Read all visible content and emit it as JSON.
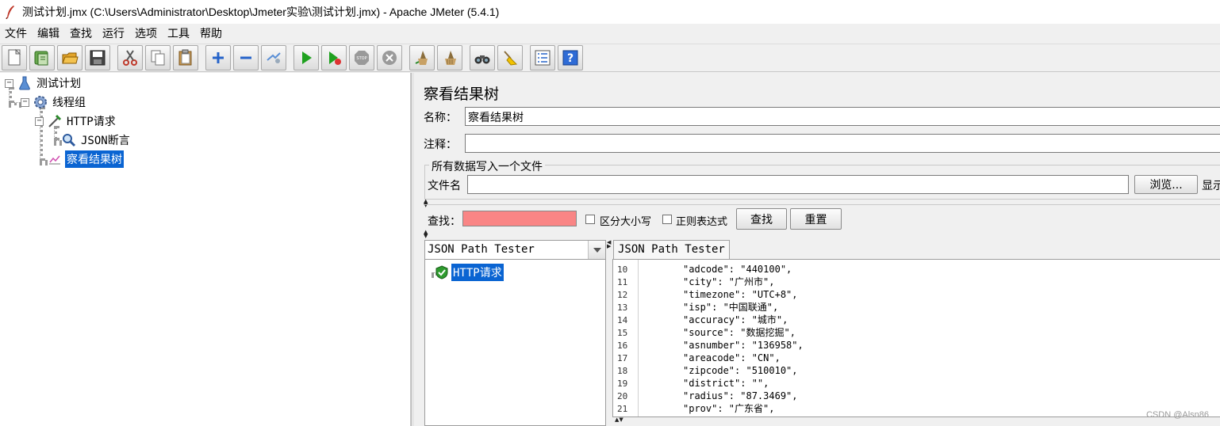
{
  "window": {
    "title": "测试计划.jmx (C:\\Users\\Administrator\\Desktop\\Jmeter实验\\测试计划.jmx) - Apache JMeter (5.4.1)"
  },
  "menu": [
    "文件",
    "编辑",
    "查找",
    "运行",
    "选项",
    "工具",
    "帮助"
  ],
  "toolbar": {
    "icons": [
      "new-icon",
      "templates-icon",
      "open-icon",
      "save-icon",
      "cut-icon",
      "copy-icon",
      "paste-icon",
      "expand-icon",
      "collapse-icon",
      "toggle-icon",
      "start-icon",
      "start-no-pause-icon",
      "stop-icon",
      "shutdown-icon",
      "clear-icon",
      "clear-all-icon",
      "search-icon",
      "reset-search-icon",
      "function-helper-icon",
      "help-icon"
    ]
  },
  "tree": {
    "nodes": [
      {
        "label": "测试计划",
        "icon": "test-plan-icon",
        "toggle": "−"
      },
      {
        "label": "线程组",
        "icon": "thread-group-icon",
        "toggle": "−"
      },
      {
        "label": "HTTP请求",
        "icon": "http-sampler-icon",
        "toggle": "−"
      },
      {
        "label": "JSON断言",
        "icon": "assertion-icon"
      },
      {
        "label": "察看结果树",
        "icon": "listener-icon",
        "selected": true
      }
    ]
  },
  "panel": {
    "title": "察看结果树",
    "name_label": "名称：",
    "name_value": "察看结果树",
    "comment_label": "注释：",
    "comment_value": "",
    "file_group_title": "所有数据写入一个文件",
    "filename_label": "文件名",
    "filename_value": "",
    "browse_button": "浏览...",
    "display_label": "显示"
  },
  "search": {
    "label": "查找：",
    "value": "",
    "case_label": "区分大小写",
    "regex_label": "正则表达式",
    "find_button": "查找",
    "reset_button": "重置"
  },
  "results": {
    "renderer": "JSON Path Tester",
    "sample_label": "HTTP请求",
    "tab_label": "JSON Path Tester",
    "lines": [
      {
        "n": "10",
        "t": "\"adcode\": \"440100\","
      },
      {
        "n": "11",
        "t": "\"city\": \"广州市\","
      },
      {
        "n": "12",
        "t": "\"timezone\": \"UTC+8\","
      },
      {
        "n": "13",
        "t": "\"isp\": \"中国联通\","
      },
      {
        "n": "14",
        "t": "\"accuracy\": \"城市\","
      },
      {
        "n": "15",
        "t": "\"source\": \"数据挖掘\","
      },
      {
        "n": "16",
        "t": "\"asnumber\": \"136958\","
      },
      {
        "n": "17",
        "t": "\"areacode\": \"CN\","
      },
      {
        "n": "18",
        "t": "\"zipcode\": \"510010\","
      },
      {
        "n": "19",
        "t": "\"district\": \"\","
      },
      {
        "n": "20",
        "t": "\"radius\": \"87.3469\","
      },
      {
        "n": "21",
        "t": "\"prov\": \"广东省\","
      }
    ]
  },
  "watermark": "CSDN @Alsn86"
}
